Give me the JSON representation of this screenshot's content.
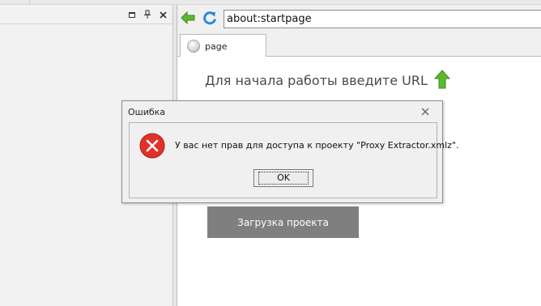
{
  "browser": {
    "url": "about:startpage",
    "tab": {
      "label": "page",
      "icon": "globe-icon"
    }
  },
  "icons": {
    "back": "back-arrow-icon",
    "refresh": "refresh-icon",
    "up_arrow": "up-arrow-icon",
    "error": "error-icon"
  },
  "start_page": {
    "prompt": "Для начала работы введите URL",
    "load_project_label": "Загрузка проекта"
  },
  "dialog": {
    "title": "Ошибка",
    "message": "У вас нет прав для доступа к проекту \"Proxy Extractor.xmlz\".",
    "ok_label": "OK"
  },
  "colors": {
    "accent_green": "#5cb82e",
    "refresh_blue": "#2a8ad8",
    "error_red": "#e0322a",
    "button_gray": "#7f7f7f"
  }
}
